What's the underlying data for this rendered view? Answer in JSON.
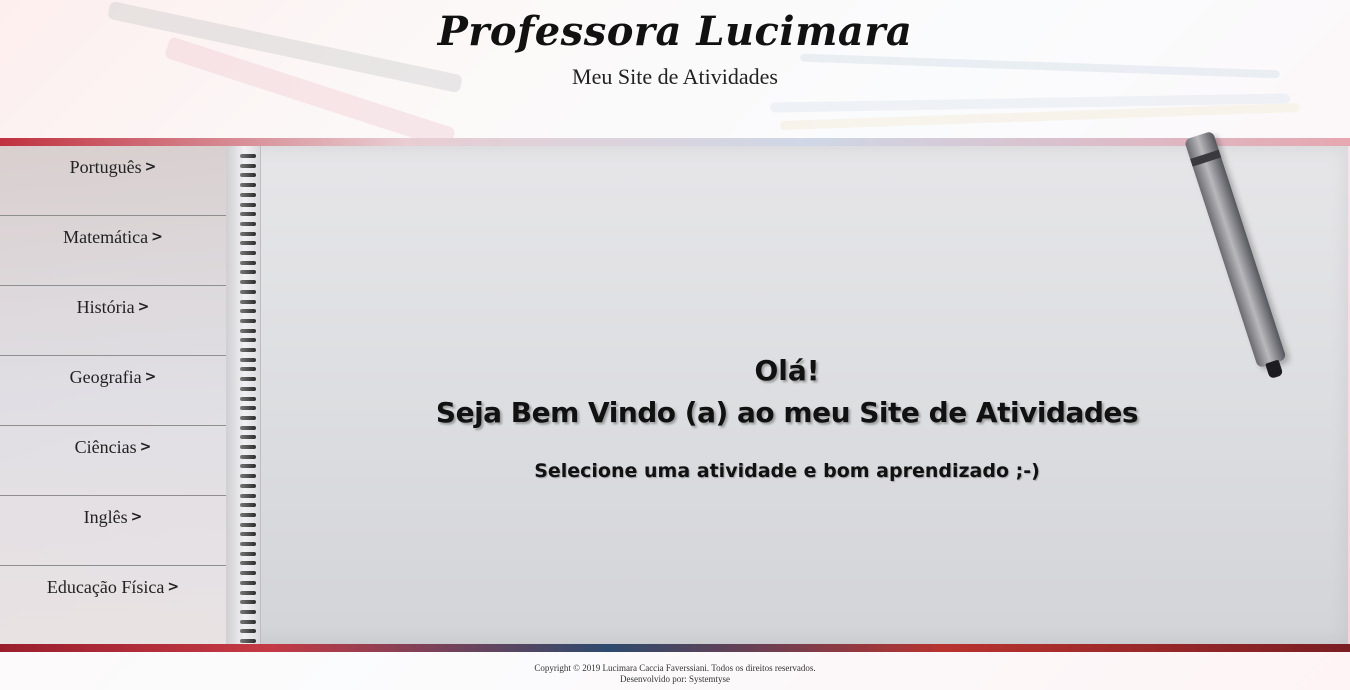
{
  "header": {
    "title": "Professora Lucimara",
    "subtitle": "Meu Site de Atividades"
  },
  "sidebar": {
    "items": [
      {
        "label": "Português",
        "icon": "chevron-right-icon"
      },
      {
        "label": "Matemática",
        "icon": "chevron-right-icon"
      },
      {
        "label": "História",
        "icon": "chevron-right-icon"
      },
      {
        "label": "Geografia",
        "icon": "chevron-right-icon"
      },
      {
        "label": "Ciências",
        "icon": "chevron-right-icon"
      },
      {
        "label": "Inglês",
        "icon": "chevron-right-icon"
      },
      {
        "label": "Educação Física",
        "icon": "chevron-right-icon"
      }
    ],
    "chevron_glyph": ">"
  },
  "main": {
    "greeting": "Olá!",
    "welcome": "Seja Bem Vindo (a) ao meu Site de Atividades",
    "hint": "Selecione uma atividade e bom aprendizado ;-)"
  },
  "footer": {
    "copyright": "Copyright © 2019 Lucimara Caccia Faverssiani. Todos os direitos reservados.",
    "developer": "Desenvolvido por: Systemtyse"
  },
  "colors": {
    "text": "#111111",
    "sidebar_divider": "#8f8f8f",
    "band_red": "#c0313f"
  }
}
